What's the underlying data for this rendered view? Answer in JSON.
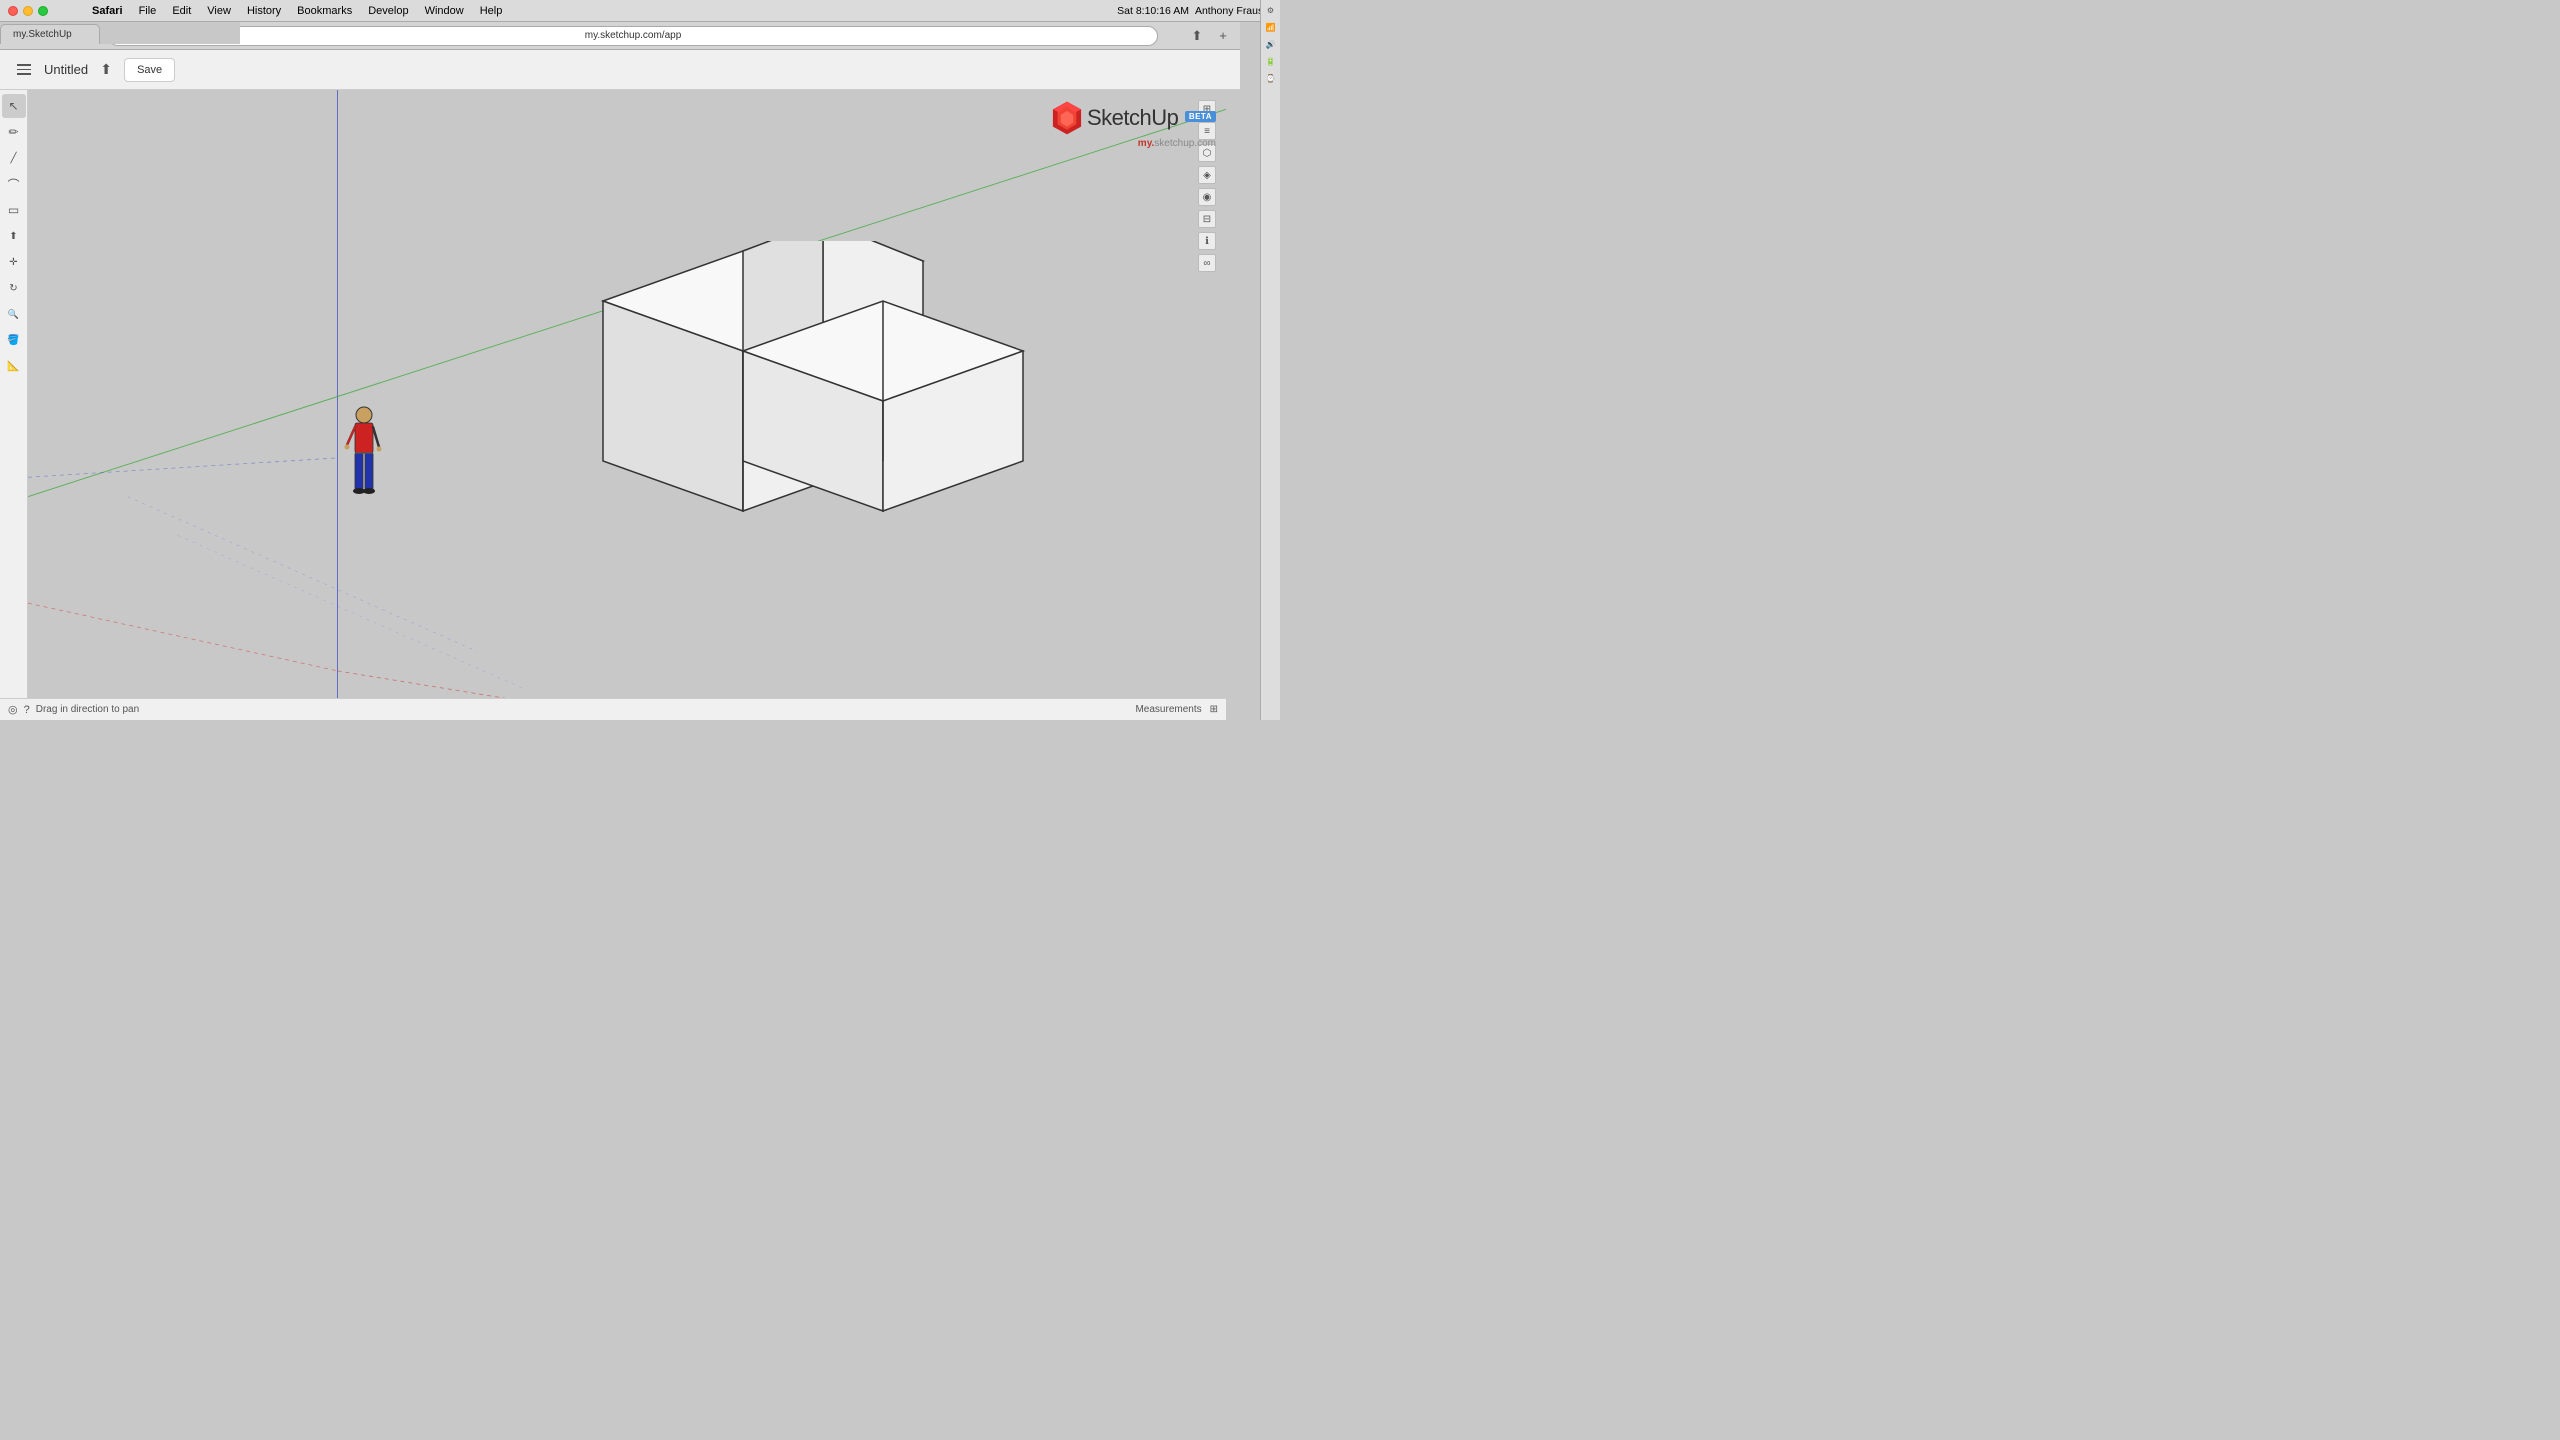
{
  "menubar": {
    "app_name": "Safari",
    "items": [
      "File",
      "Edit",
      "View",
      "History",
      "Bookmarks",
      "Develop",
      "Window",
      "Help"
    ],
    "url": "my.sketchup.com/app",
    "tab_title": "my.SketchUp",
    "time": "Sat 8:10:16 AM",
    "user": "Anthony Frausto"
  },
  "app": {
    "title": "Untitled",
    "save_label": "Save",
    "status_text": "Drag in direction to pan",
    "measurements_label": "Measurements"
  },
  "logo": {
    "text": "SketchUp",
    "beta_label": "BETA",
    "url_prefix": "my.",
    "url_suffix": "sketchup.com"
  },
  "tools": {
    "items": [
      {
        "name": "select",
        "icon": "↖"
      },
      {
        "name": "pencil",
        "icon": "✏"
      },
      {
        "name": "line",
        "icon": "/"
      },
      {
        "name": "arc",
        "icon": "⌒"
      },
      {
        "name": "rectangle",
        "icon": "▭"
      },
      {
        "name": "push-pull",
        "icon": "⬆"
      },
      {
        "name": "move",
        "icon": "✥"
      },
      {
        "name": "orbit",
        "icon": "↻"
      },
      {
        "name": "zoom",
        "icon": "🔍"
      },
      {
        "name": "paint",
        "icon": "🪣"
      },
      {
        "name": "measure",
        "icon": "📐"
      }
    ]
  },
  "viewport_icons": [
    {
      "name": "scene-icon",
      "icon": "⊞"
    },
    {
      "name": "layers-icon",
      "icon": "≡"
    },
    {
      "name": "components-icon",
      "icon": "⬡"
    },
    {
      "name": "materials-icon",
      "icon": "◈"
    },
    {
      "name": "styles-icon",
      "icon": "◉"
    },
    {
      "name": "outliner-icon",
      "icon": "⊟"
    },
    {
      "name": "entity-info-icon",
      "icon": "ℹ"
    },
    {
      "name": "infinity-icon",
      "icon": "∞"
    }
  ]
}
